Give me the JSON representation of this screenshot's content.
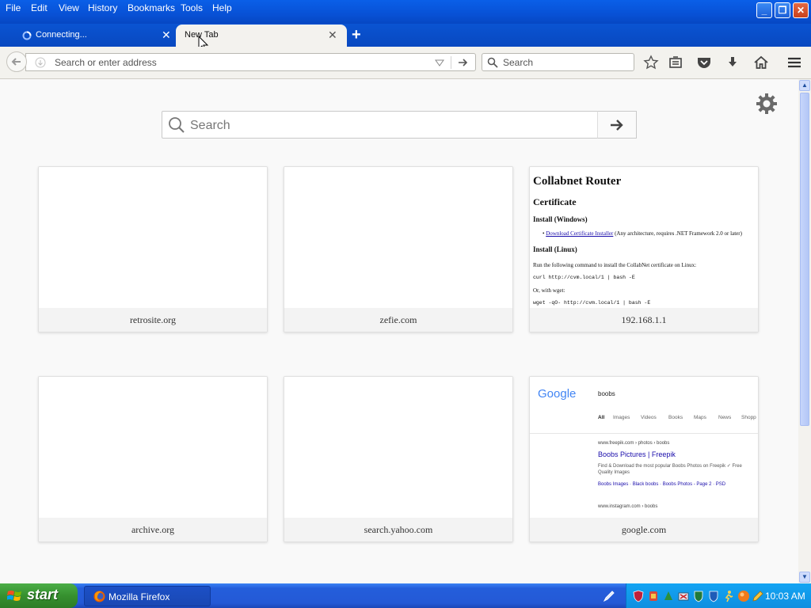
{
  "window": {
    "menu": [
      "File",
      "Edit",
      "View",
      "History",
      "Bookmarks",
      "Tools",
      "Help"
    ]
  },
  "tabs": [
    {
      "label": "Connecting...",
      "active": false
    },
    {
      "label": "New Tab",
      "active": true
    }
  ],
  "navbar": {
    "url_placeholder": "Search or enter address",
    "search_placeholder": "Search"
  },
  "newtab": {
    "search_placeholder": "Search",
    "tiles": [
      {
        "caption": "retrosite.org"
      },
      {
        "caption": "zefie.com"
      },
      {
        "caption": "192.168.1.1"
      },
      {
        "caption": "archive.org"
      },
      {
        "caption": "search.yahoo.com"
      },
      {
        "caption": "google.com"
      }
    ],
    "collabnet_thumb": {
      "title": "Collabnet Router",
      "h2": "Certificate",
      "h3_windows": "Install (Windows)",
      "link": "Download Certificate Installer",
      "link_note": "(Any architecture, requires .NET Framework 2.0 or later)",
      "h3_linux": "Install (Linux)",
      "para": "Run the following command to install the CollabNet certificate on Linux:",
      "cmd1": "curl http://cvm.local/1 | bash -E",
      "or": "Or, with wget:",
      "cmd2": "wget -qO- http://cvm.local/1 | bash -E"
    },
    "google_thumb": {
      "logo": "Google",
      "query": "boobs",
      "nav": [
        "All",
        "Images",
        "Videos",
        "Books",
        "Maps",
        "News",
        "Shopp"
      ],
      "r1_url": "www.freepik.com › photos › boobs",
      "r1_title": "Boobs Pictures | Freepik",
      "r1_desc1": "Find & Download the most popular Boobs Photos on Freepik ✓ Free",
      "r1_desc2": "Quality Images",
      "r1_links": "Boobs Images · Black boobs · Boobs Photos - Page 2 · PSD",
      "r2_url": "www.instagram.com › boobs"
    }
  },
  "taskbar": {
    "start": "start",
    "item": "Mozilla Firefox",
    "clock": "10:03 AM"
  },
  "colors": {
    "xp_blue": "#0851d6",
    "start_green": "#36902f",
    "link_blue": "#1a0dab"
  }
}
